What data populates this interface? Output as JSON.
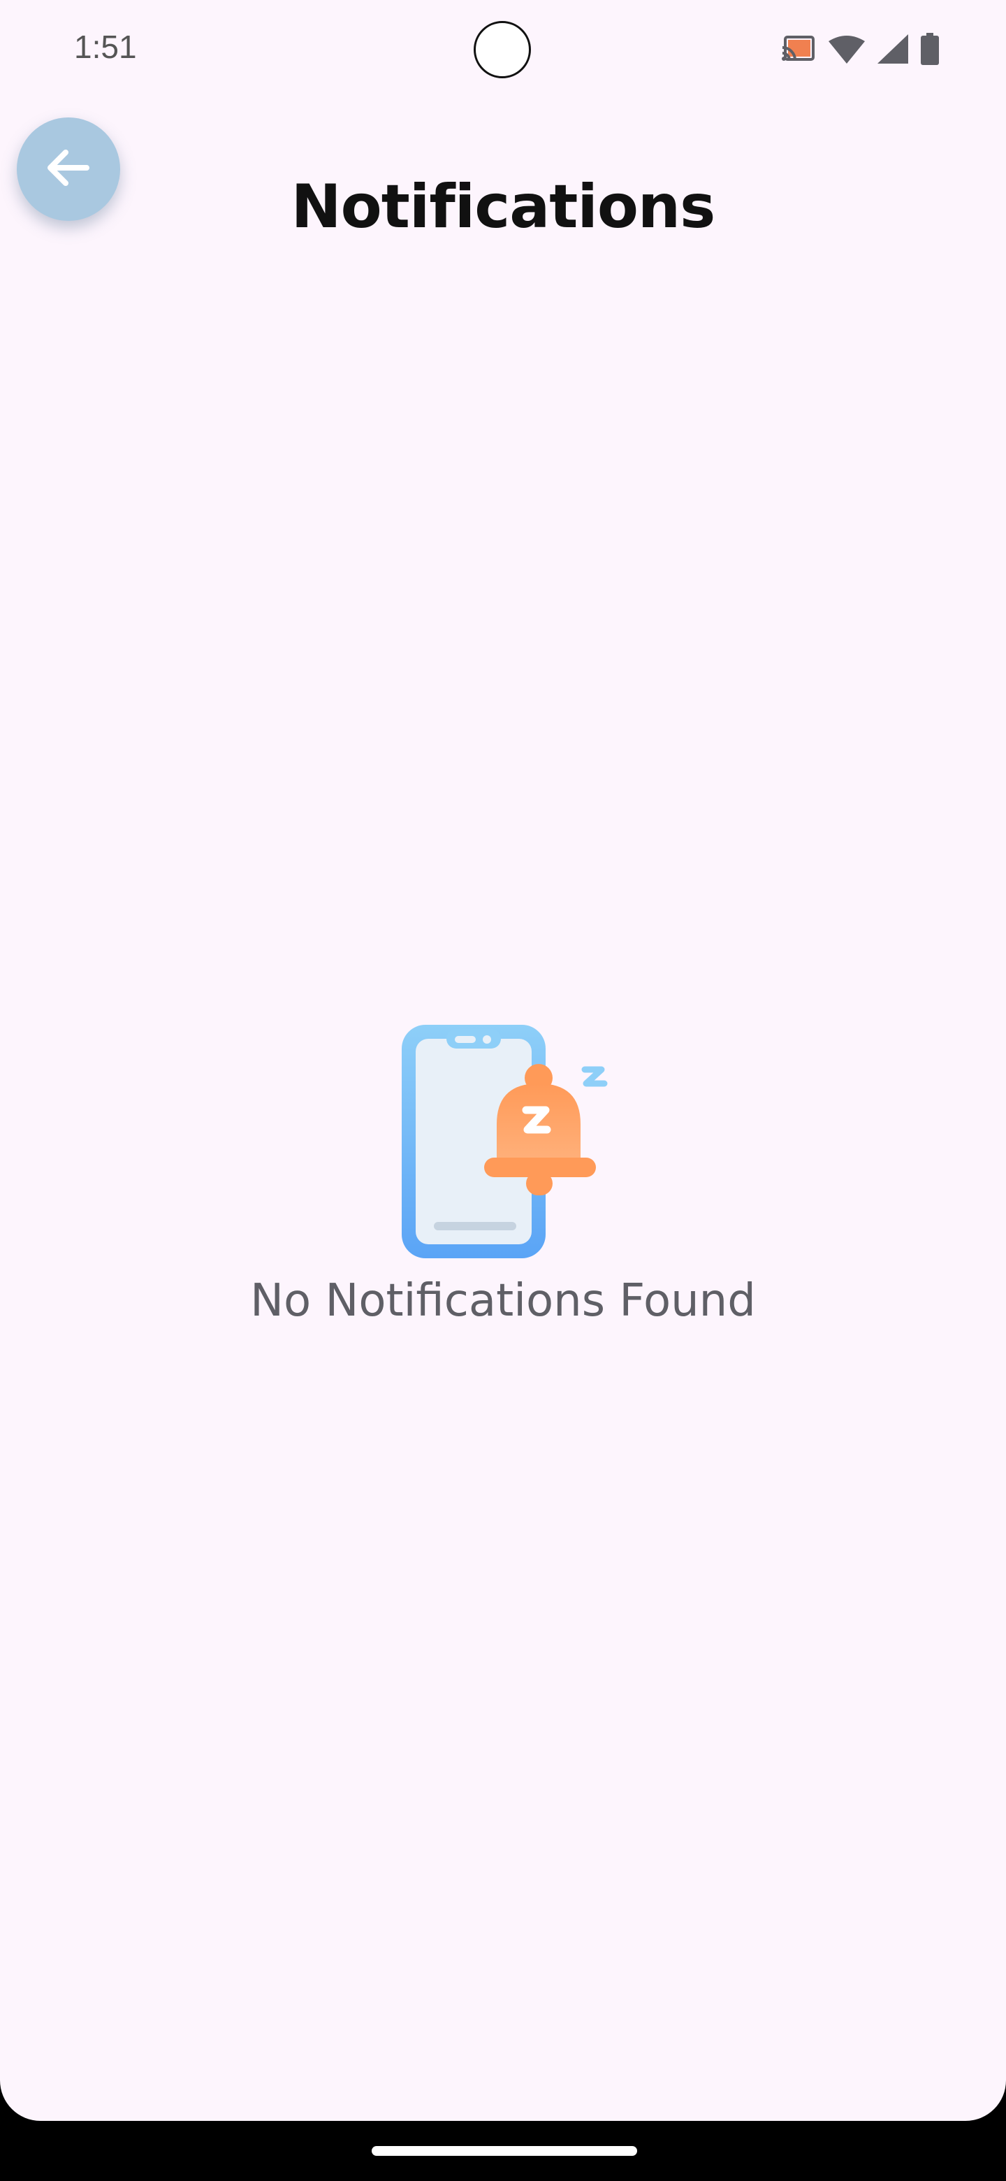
{
  "status_bar": {
    "time": "1:51",
    "icons": [
      "cast-icon",
      "wifi-icon",
      "signal-icon",
      "battery-icon"
    ]
  },
  "header": {
    "title": "Notifications",
    "back_icon": "arrow-left-icon"
  },
  "empty_state": {
    "illustration": "phone-sleeping-bell-icon",
    "message": "No Notifications Found"
  },
  "colors": {
    "background": "#fdf5fd",
    "back_button": "#a9c8e0",
    "bell": "#ff9a5c",
    "phone": "#5aaaf5",
    "title_text": "#111111",
    "message_text": "#5f5f66"
  }
}
